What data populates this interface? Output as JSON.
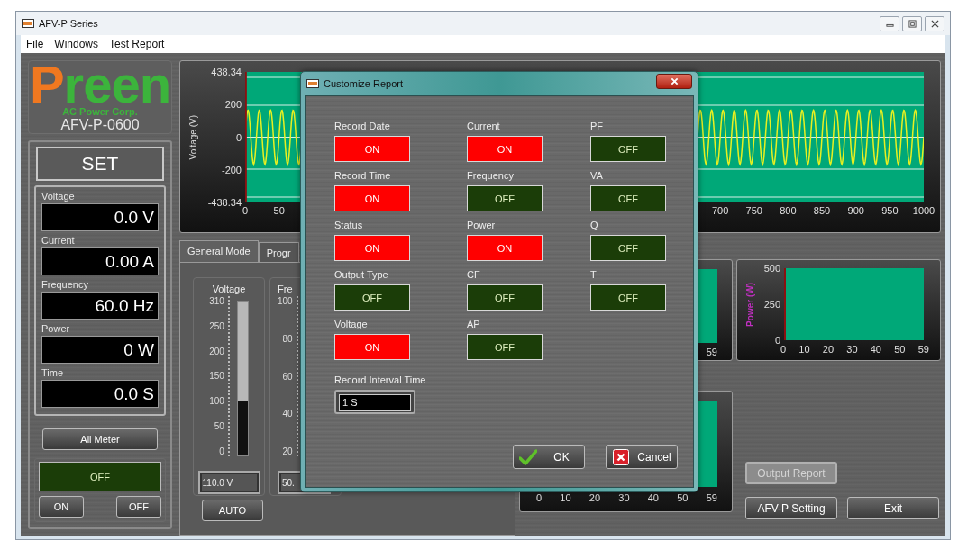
{
  "window": {
    "title": "AFV-P Series"
  },
  "menu": [
    "File",
    "Windows",
    "Test Report"
  ],
  "logo": {
    "brand_parts": [
      {
        "text": "P",
        "color": "#f07820"
      },
      {
        "text": "reen",
        "color": "#3cb43c"
      }
    ],
    "tagline": "AC Power Corp.",
    "model": "AFV-P-0600"
  },
  "set_panel": {
    "title": "SET",
    "readings": [
      {
        "label": "Voltage",
        "value": "0.0 V"
      },
      {
        "label": "Current",
        "value": "0.00 A"
      },
      {
        "label": "Frequency",
        "value": "60.0 Hz"
      },
      {
        "label": "Power",
        "value": "0 W"
      },
      {
        "label": "Time",
        "value": "0.0 S"
      }
    ],
    "all_meter_button": "All Meter",
    "output_status": {
      "label": "OFF",
      "on": false
    },
    "buttons": [
      "ON",
      "OFF"
    ]
  },
  "voltage_chart": {
    "ylabel": "Voltage (V)",
    "y_ticks": [
      "438.34",
      "200",
      "0",
      "-200",
      "-438.34"
    ],
    "x_ticks_start": [
      "0",
      "50"
    ],
    "x_ticks_end": [
      "700",
      "750",
      "800",
      "850",
      "900",
      "950",
      "1000"
    ]
  },
  "tabs": [
    {
      "label": "General Mode",
      "selected": true
    },
    {
      "label": "Progr",
      "selected": false
    }
  ],
  "gauges": [
    {
      "title": "Voltage",
      "ticks": [
        "310",
        "250",
        "200",
        "150",
        "100",
        "50",
        "0"
      ],
      "level": 0.35,
      "value": "110.0 V"
    },
    {
      "title": "Fre",
      "ticks": [
        "100",
        "80",
        "60",
        "40",
        "20"
      ],
      "value": "50."
    }
  ],
  "auto_button": "AUTO",
  "middle_chart": {
    "x_ticks": [
      "59"
    ]
  },
  "power_chart": {
    "ylabel": "Power (W)",
    "y_ticks": [
      "500",
      "250",
      "0"
    ],
    "x_ticks": [
      "0",
      "10",
      "20",
      "30",
      "40",
      "50",
      "59"
    ]
  },
  "bottom_chart": {
    "x_ticks": [
      "0",
      "10",
      "20",
      "30",
      "40",
      "50",
      "59"
    ]
  },
  "buttons": [
    {
      "label": "Output Report",
      "disabled": true
    },
    {
      "label": "AFV-P Setting",
      "disabled": false
    },
    {
      "label": "Exit",
      "disabled": false
    }
  ],
  "dialog": {
    "title": "Customize Report",
    "columns": [
      [
        {
          "label": "Record Date",
          "value": "ON",
          "on": true
        },
        {
          "label": "Record Time",
          "value": "ON",
          "on": true
        },
        {
          "label": "Status",
          "value": "ON",
          "on": true
        },
        {
          "label": "Output Type",
          "value": "OFF",
          "on": false
        },
        {
          "label": "Voltage",
          "value": "ON",
          "on": true
        }
      ],
      [
        {
          "label": "Current",
          "value": "ON",
          "on": true
        },
        {
          "label": "Frequency",
          "value": "OFF",
          "on": false
        },
        {
          "label": "Power",
          "value": "ON",
          "on": true
        },
        {
          "label": "CF",
          "value": "OFF",
          "on": false
        },
        {
          "label": "AP",
          "value": "OFF",
          "on": false
        }
      ],
      [
        {
          "label": "PF",
          "value": "OFF",
          "on": false
        },
        {
          "label": "VA",
          "value": "OFF",
          "on": false
        },
        {
          "label": "Q",
          "value": "OFF",
          "on": false
        },
        {
          "label": "T",
          "value": "OFF",
          "on": false
        }
      ]
    ],
    "interval": {
      "label": "Record Interval Time",
      "value": "1 S"
    },
    "buttons": [
      {
        "kind": "ok",
        "label": "OK"
      },
      {
        "kind": "cancel",
        "label": "Cancel"
      }
    ]
  }
}
